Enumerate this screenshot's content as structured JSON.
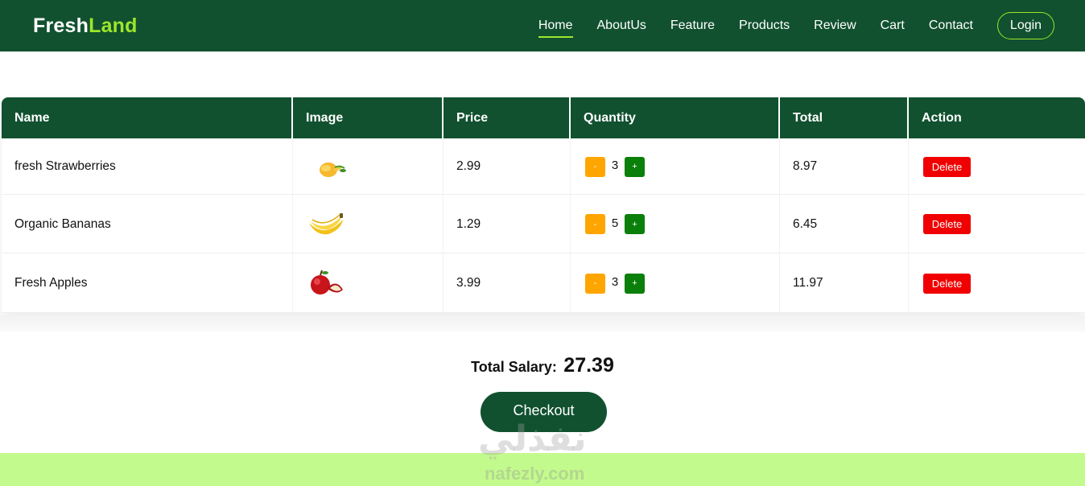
{
  "brand": {
    "part1": "Fresh",
    "part2": "Land"
  },
  "nav": {
    "items": [
      "Home",
      "AboutUs",
      "Feature",
      "Products",
      "Review",
      "Cart",
      "Contact"
    ],
    "active": "Home",
    "login_label": "Login"
  },
  "table": {
    "headers": [
      "Name",
      "Image",
      "Price",
      "Quantity",
      "Total",
      "Action"
    ],
    "rows": [
      {
        "name": "fresh Strawberries",
        "image": "mango-icon",
        "price": "2.99",
        "minus": "-",
        "qty": "3",
        "plus": "+",
        "total": "8.97",
        "action": "Delete"
      },
      {
        "name": "Organic Bananas",
        "image": "banana-icon",
        "price": "1.29",
        "minus": "-",
        "qty": "5",
        "plus": "+",
        "total": "6.45",
        "action": "Delete"
      },
      {
        "name": "Fresh Apples",
        "image": "apple-icon",
        "price": "3.99",
        "minus": "-",
        "qty": "3",
        "plus": "+",
        "total": "11.97",
        "action": "Delete"
      }
    ]
  },
  "summary": {
    "label": "Total Salary:",
    "value": "27.39"
  },
  "checkout_label": "Checkout",
  "watermark": {
    "arabic": "نفذلي",
    "latin": "nafezly.com"
  },
  "colors": {
    "primary": "#11512f",
    "accent": "#9ce62b",
    "minus": "#ffa500",
    "plus": "#0a7f0a",
    "delete": "#f00000",
    "footer": "#c3fa8d"
  }
}
